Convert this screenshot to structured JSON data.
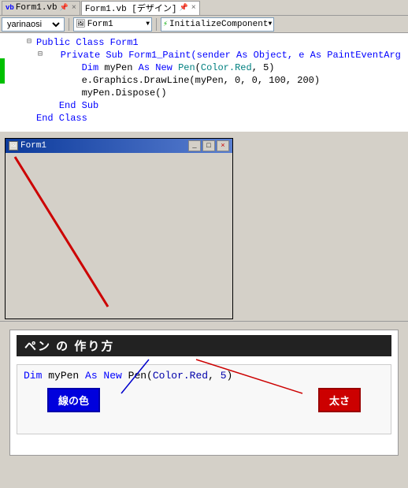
{
  "tabs": [
    {
      "label": "Form1.vb",
      "icon": "vb",
      "active": false,
      "closable": true
    },
    {
      "label": "Form1.vb [デザイン]",
      "icon": "",
      "active": true,
      "closable": true
    }
  ],
  "toolbar": {
    "left_dropdown": "yarinaosi",
    "middle_label": "Form1",
    "right_label": "InitializeComponent"
  },
  "code": {
    "lines": [
      {
        "indent": 0,
        "expand": "⊟",
        "text": "Public Class Form1",
        "color": "blue"
      },
      {
        "indent": 1,
        "expand": "⊟",
        "text": "Private Sub Form1_Paint(sender As Object, e As PaintEventArg",
        "color": "blue"
      },
      {
        "indent": 2,
        "expand": "",
        "text": "Dim myPen As New Pen(Color.Red, 5)",
        "color": "mixed"
      },
      {
        "indent": 2,
        "expand": "",
        "text": "e.Graphics.DrawLine(myPen, 0, 0, 100, 200)",
        "color": "black"
      },
      {
        "indent": 2,
        "expand": "",
        "text": "myPen.Dispose()",
        "color": "black"
      },
      {
        "indent": 1,
        "expand": "",
        "text": "End Sub",
        "color": "blue"
      },
      {
        "indent": 0,
        "expand": "",
        "text": "End Class",
        "color": "blue"
      }
    ]
  },
  "form_window": {
    "title": "Form1",
    "buttons": [
      "_",
      "□",
      "×"
    ]
  },
  "tutorial": {
    "header": "ペン の 作り方",
    "code_line": "Dim myPen As New Pen(Color.Red, 5)",
    "btn_color_label": "線の色",
    "btn_thickness_label": "太さ"
  }
}
